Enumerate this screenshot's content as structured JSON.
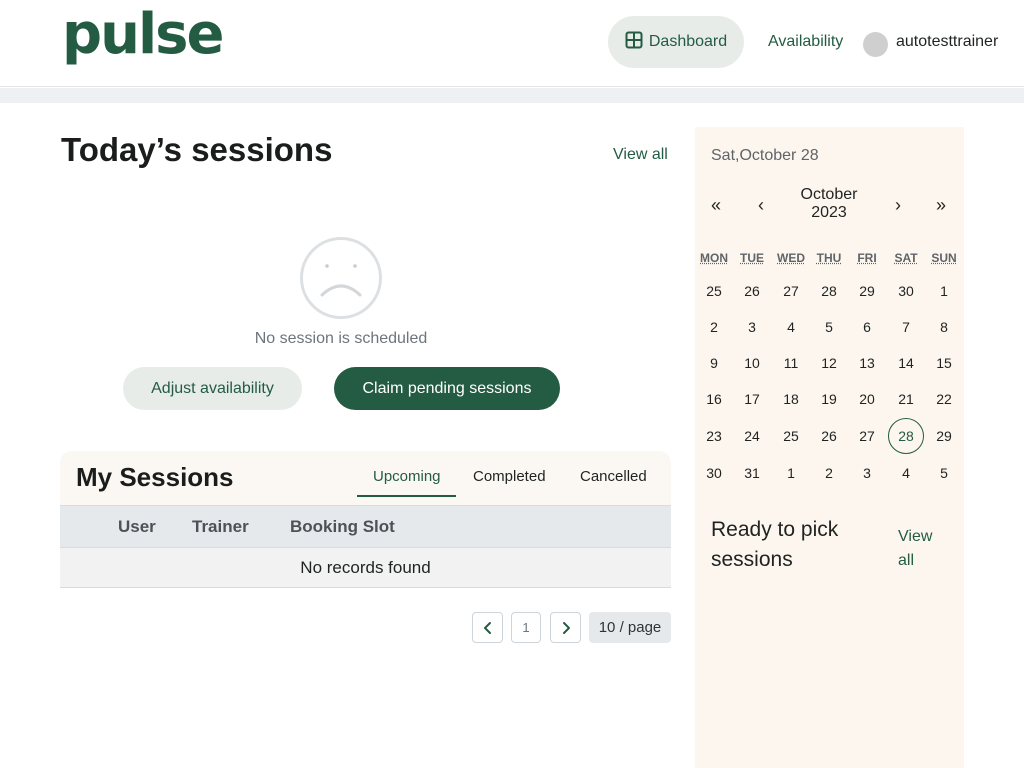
{
  "header": {
    "logo": "pulse",
    "nav": {
      "dashboard": "Dashboard",
      "availability": "Availability"
    },
    "user": {
      "name": "autotesttrainer"
    }
  },
  "today": {
    "title": "Today’s sessions",
    "view_all": "View all",
    "empty_text": "No session is scheduled",
    "adjust_button": "Adjust availability",
    "claim_button": "Claim pending sessions"
  },
  "my_sessions": {
    "title": "My Sessions",
    "tabs": [
      {
        "label": "Upcoming",
        "active": true
      },
      {
        "label": "Completed",
        "active": false
      },
      {
        "label": "Cancelled",
        "active": false
      }
    ],
    "columns": [
      "User",
      "Trainer",
      "Booking Slot"
    ],
    "empty_text": "No records found",
    "pagination": {
      "current_page": "1",
      "page_size": "10 / page"
    }
  },
  "calendar": {
    "selected_date_text": "Sat,October 28",
    "nav": {
      "prev_year": "«",
      "prev_month": "‹",
      "next_month": "›",
      "next_year": "»"
    },
    "month_label": "October",
    "year_label": "2023",
    "weekdays": [
      "MON",
      "TUE",
      "WED",
      "THU",
      "FRI",
      "SAT",
      "SUN"
    ],
    "weeks": [
      [
        "25",
        "26",
        "27",
        "28",
        "29",
        "30",
        "1"
      ],
      [
        "2",
        "3",
        "4",
        "5",
        "6",
        "7",
        "8"
      ],
      [
        "9",
        "10",
        "11",
        "12",
        "13",
        "14",
        "15"
      ],
      [
        "16",
        "17",
        "18",
        "19",
        "20",
        "21",
        "22"
      ],
      [
        "23",
        "24",
        "25",
        "26",
        "27",
        "28",
        "29"
      ],
      [
        "30",
        "31",
        "1",
        "2",
        "3",
        "4",
        "5"
      ]
    ],
    "selected_day": "28"
  },
  "ready": {
    "title": "Ready to pick sessions",
    "view_all": "View all"
  },
  "colors": {
    "brand": "#245c43",
    "brand_light": "#e7ece9",
    "panel_bg": "#fdf6ee",
    "table_head_bg": "#e6e9ec"
  }
}
